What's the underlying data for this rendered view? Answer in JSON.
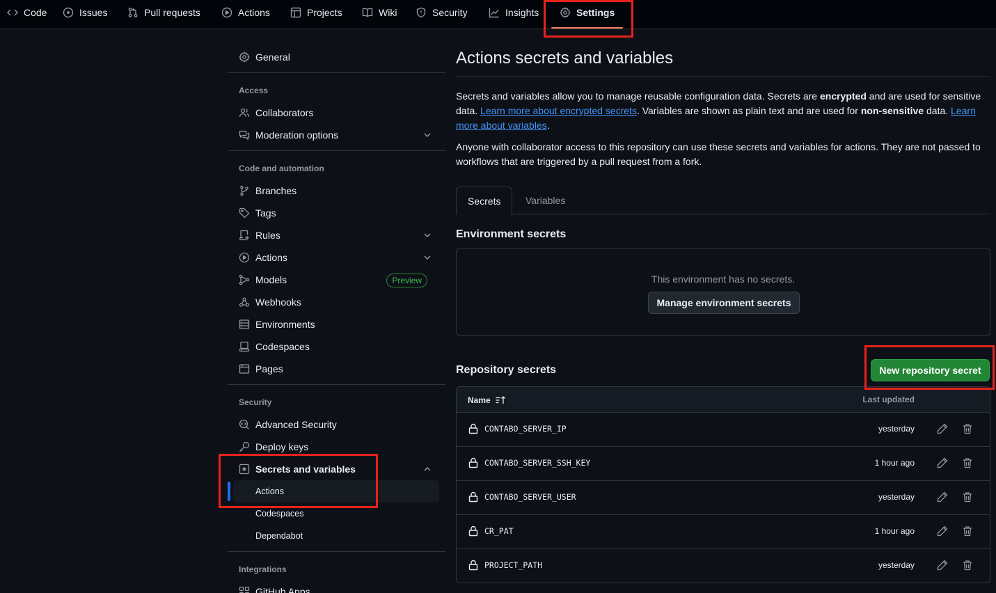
{
  "topnav": {
    "tabs": [
      {
        "label": "Code",
        "icon": "code-icon"
      },
      {
        "label": "Issues",
        "icon": "issue-icon"
      },
      {
        "label": "Pull requests",
        "icon": "pull-request-icon"
      },
      {
        "label": "Actions",
        "icon": "play-icon"
      },
      {
        "label": "Projects",
        "icon": "table-icon"
      },
      {
        "label": "Wiki",
        "icon": "book-icon"
      },
      {
        "label": "Security",
        "icon": "shield-icon"
      },
      {
        "label": "Insights",
        "icon": "graph-icon"
      },
      {
        "label": "Settings",
        "icon": "gear-icon",
        "active": true
      }
    ]
  },
  "sidebar": {
    "general": "General",
    "access_heading": "Access",
    "collaborators": "Collaborators",
    "moderation": "Moderation options",
    "code_heading": "Code and automation",
    "branches": "Branches",
    "tags": "Tags",
    "rules": "Rules",
    "actions": "Actions",
    "models": "Models",
    "models_badge": "Preview",
    "webhooks": "Webhooks",
    "environments": "Environments",
    "codespaces": "Codespaces",
    "pages": "Pages",
    "security_heading": "Security",
    "advanced_security": "Advanced Security",
    "deploy_keys": "Deploy keys",
    "secrets_vars": "Secrets and variables",
    "sub_actions": "Actions",
    "sub_codespaces": "Codespaces",
    "sub_dependabot": "Dependabot",
    "integrations_heading": "Integrations",
    "github_apps": "GitHub Apps"
  },
  "main": {
    "title": "Actions secrets and variables",
    "intro": {
      "p1_a": "Secrets and variables allow you to manage reusable configuration data. Secrets are ",
      "p1_b": "encrypted",
      "p1_c": " and are used for sensitive data. ",
      "link1": "Learn more about encrypted secrets",
      "p1_d": ". Variables are shown as plain text and are used for ",
      "p1_e": "non-sensitive",
      "p1_f": " data. ",
      "link2": "Learn more about variables",
      "p1_g": ".",
      "p2": "Anyone with collaborator access to this repository can use these secrets and variables for actions. They are not passed to workflows that are triggered by a pull request from a fork."
    },
    "tabs": {
      "secrets": "Secrets",
      "variables": "Variables"
    },
    "env_title": "Environment secrets",
    "env_empty": "This environment has no secrets.",
    "env_button": "Manage environment secrets",
    "repo_title": "Repository secrets",
    "new_button": "New repository secret",
    "table": {
      "col_name": "Name",
      "col_updated": "Last updated",
      "rows": [
        {
          "name": "CONTABO_SERVER_IP",
          "updated": "yesterday"
        },
        {
          "name": "CONTABO_SERVER_SSH_KEY",
          "updated": "1 hour ago"
        },
        {
          "name": "CONTABO_SERVER_USER",
          "updated": "yesterday"
        },
        {
          "name": "CR_PAT",
          "updated": "1 hour ago"
        },
        {
          "name": "PROJECT_PATH",
          "updated": "yesterday"
        }
      ]
    }
  },
  "colors": {
    "background": "#0d1117",
    "accent_blue": "#4493f8",
    "green_button": "#238636",
    "highlight_red": "#e5231b",
    "active_underline": "#f78166"
  }
}
